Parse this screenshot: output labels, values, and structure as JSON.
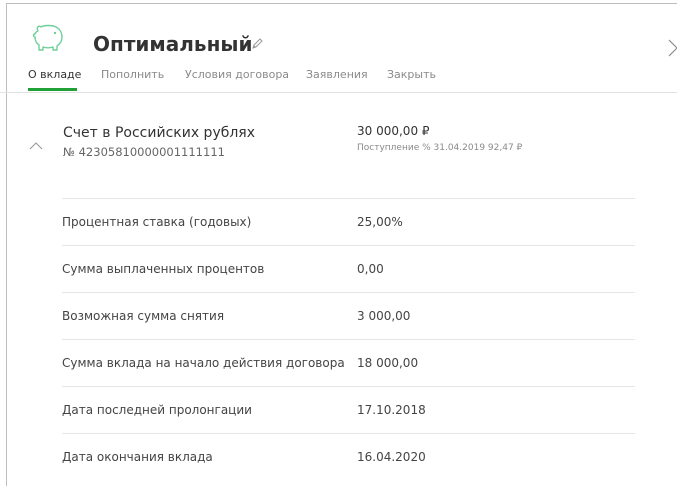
{
  "header": {
    "title": "Оптимальный"
  },
  "tabs": [
    {
      "label": "О вкладе",
      "active": true
    },
    {
      "label": "Пополнить",
      "active": false
    },
    {
      "label": "Условия договора",
      "active": false
    },
    {
      "label": "Заявления",
      "active": false
    },
    {
      "label": "Закрыть",
      "active": false
    }
  ],
  "account": {
    "name": "Счет в Российских рублях",
    "number": "№ 42305810000001111111",
    "amount": "30 000,00 ₽",
    "income": "Поступление % 31.04.2019 92,47 ₽"
  },
  "details": [
    {
      "label": "Процентная ставка (годовых)",
      "value": "25,00%"
    },
    {
      "label": "Сумма выплаченных процентов",
      "value": "0,00"
    },
    {
      "label": "Возможная сумма снятия",
      "value": "3 000,00"
    },
    {
      "label": "Сумма вклада на начало действия договора",
      "value": "18 000,00"
    },
    {
      "label": "Дата последней пролонгации",
      "value": "17.10.2018"
    },
    {
      "label": "Дата окончания вклада",
      "value": "16.04.2020"
    }
  ],
  "colors": {
    "accent": "#21a038",
    "icon_outline": "#6fcf9a",
    "text": "#333333",
    "muted": "#8a8a8a"
  },
  "icons": [
    "piggy-bank-icon",
    "pencil-icon",
    "close-icon",
    "chevron-up-icon"
  ]
}
